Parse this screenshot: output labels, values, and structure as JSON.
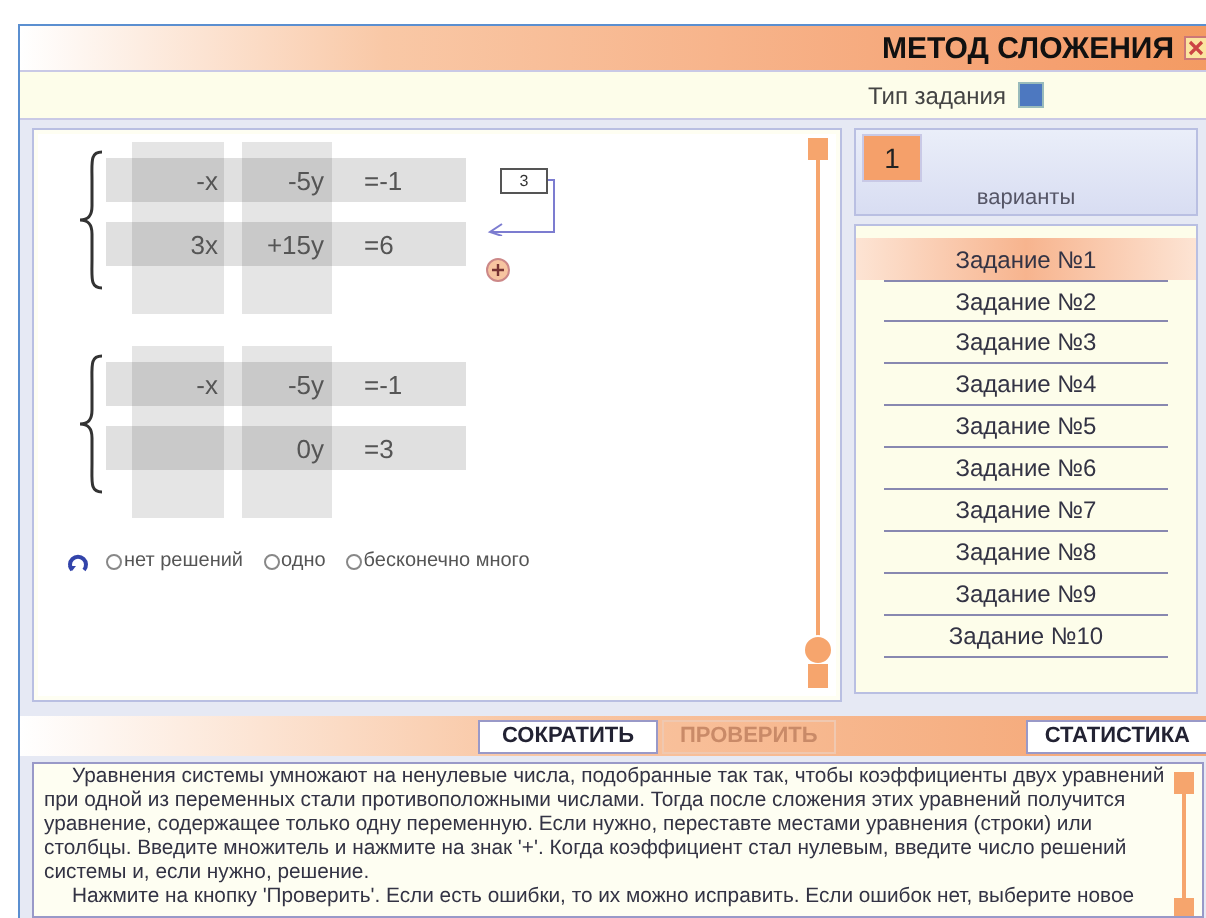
{
  "window": {
    "title": "МЕТОД СЛОЖЕНИЯ"
  },
  "task_type": {
    "label": "Тип задания"
  },
  "systems": [
    {
      "rows": [
        {
          "x": "-x",
          "y": "-5y",
          "eq": "=-1"
        },
        {
          "x": "3x",
          "y": "+15y",
          "eq": "=6"
        }
      ],
      "multiplier": "3"
    },
    {
      "rows": [
        {
          "x": "-x",
          "y": "-5y",
          "eq": "=-1"
        },
        {
          "x": "",
          "y": "0y",
          "eq": "=3"
        }
      ]
    }
  ],
  "solution_options": [
    {
      "label": "нет решений",
      "selected": false
    },
    {
      "label": "одно",
      "selected": false
    },
    {
      "label": "бесконечно много",
      "selected": false
    }
  ],
  "variant": {
    "value": "1",
    "label": "варианты"
  },
  "tasks": [
    {
      "label": "Задание №1",
      "selected": true
    },
    {
      "label": "Задание №2",
      "selected": false
    },
    {
      "label": "Задание №3",
      "selected": false
    },
    {
      "label": "Задание №4",
      "selected": false
    },
    {
      "label": "Задание №5",
      "selected": false
    },
    {
      "label": "Задание №6",
      "selected": false
    },
    {
      "label": "Задание №7",
      "selected": false
    },
    {
      "label": "Задание №8",
      "selected": false
    },
    {
      "label": "Задание №9",
      "selected": false
    },
    {
      "label": "Задание №10",
      "selected": false
    }
  ],
  "buttons": [
    {
      "label": "СОКРАТИТЬ",
      "disabled": false
    },
    {
      "label": "ПРОВЕРИТЬ",
      "disabled": true
    },
    {
      "label": "СТАТИСТИКА",
      "disabled": false
    }
  ],
  "help_text": [
    "Уравнения системы умножают на ненулевые числа, подобранные так так, чтобы коэффициенты двух уравнений при одной из переменных стали противоположными числами. Тогда после сложения этих уравнений получится уравнение, содержащее только одну переменную. Если нужно, переставте местами уравнения (строки) или столбцы. Введите множитель и нажмите на знак '+'. Когда коэффициент стал нулевым, введите число решений системы и, если нужно, решение.",
    "Нажмите на кнопку 'Проверить'. Если есть ошибки, то их можно исправить. Если ошибок нет, выберите новое"
  ]
}
